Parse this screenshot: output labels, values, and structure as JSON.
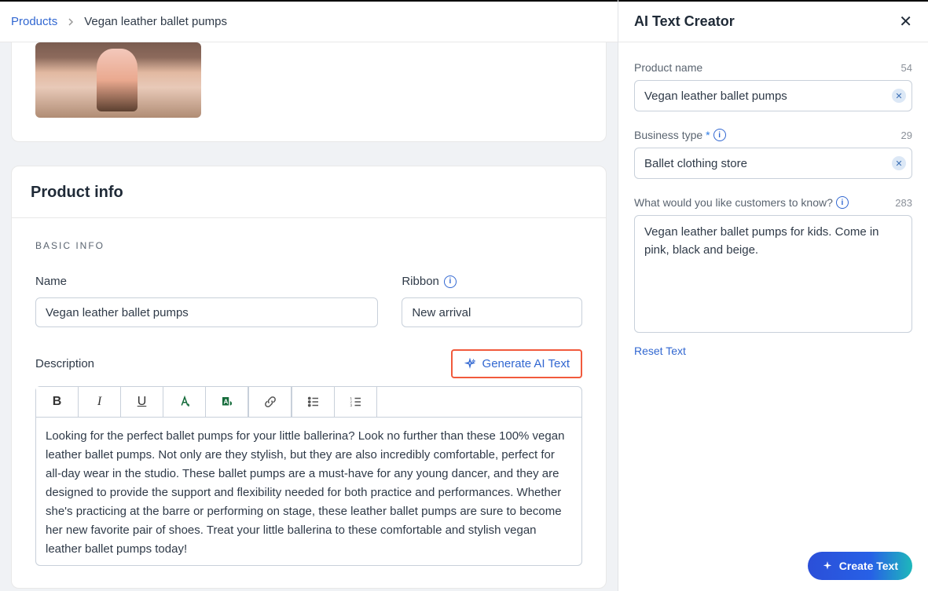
{
  "breadcrumb": {
    "parent": "Products",
    "current": "Vegan leather ballet pumps"
  },
  "productInfo": {
    "card_title": "Product info",
    "basic_info_label": "BASIC INFO",
    "name_label": "Name",
    "name_value": "Vegan leather ballet pumps",
    "ribbon_label": "Ribbon",
    "ribbon_value": "New arrival",
    "description_label": "Description",
    "generate_ai_label": "Generate AI Text",
    "description_text": "Looking for the perfect ballet pumps for your little ballerina? Look no further than these 100% vegan leather ballet pumps. Not only are they stylish, but they are also incredibly comfortable, perfect for all-day wear in the studio. These ballet pumps are a must-have for any young dancer, and they are designed to provide the support and flexibility needed for both practice and performances. Whether she's practicing at the barre or performing on stage, these leather ballet pumps are sure to become her new favorite pair of shoes. Treat your little ballerina to these comfortable and stylish vegan leather ballet pumps today!"
  },
  "sidebar": {
    "title": "AI Text Creator",
    "product_name_label": "Product name",
    "product_name_count": "54",
    "product_name_value": "Vegan leather ballet pumps",
    "business_type_label": "Business type",
    "business_type_count": "29",
    "business_type_value": "Ballet clothing store",
    "customers_know_label": "What would you like customers to know?",
    "customers_know_count": "283",
    "customers_know_value": "Vegan leather ballet pumps for kids. Come in pink, black and beige.",
    "reset_label": "Reset Text",
    "create_label": "Create Text"
  }
}
